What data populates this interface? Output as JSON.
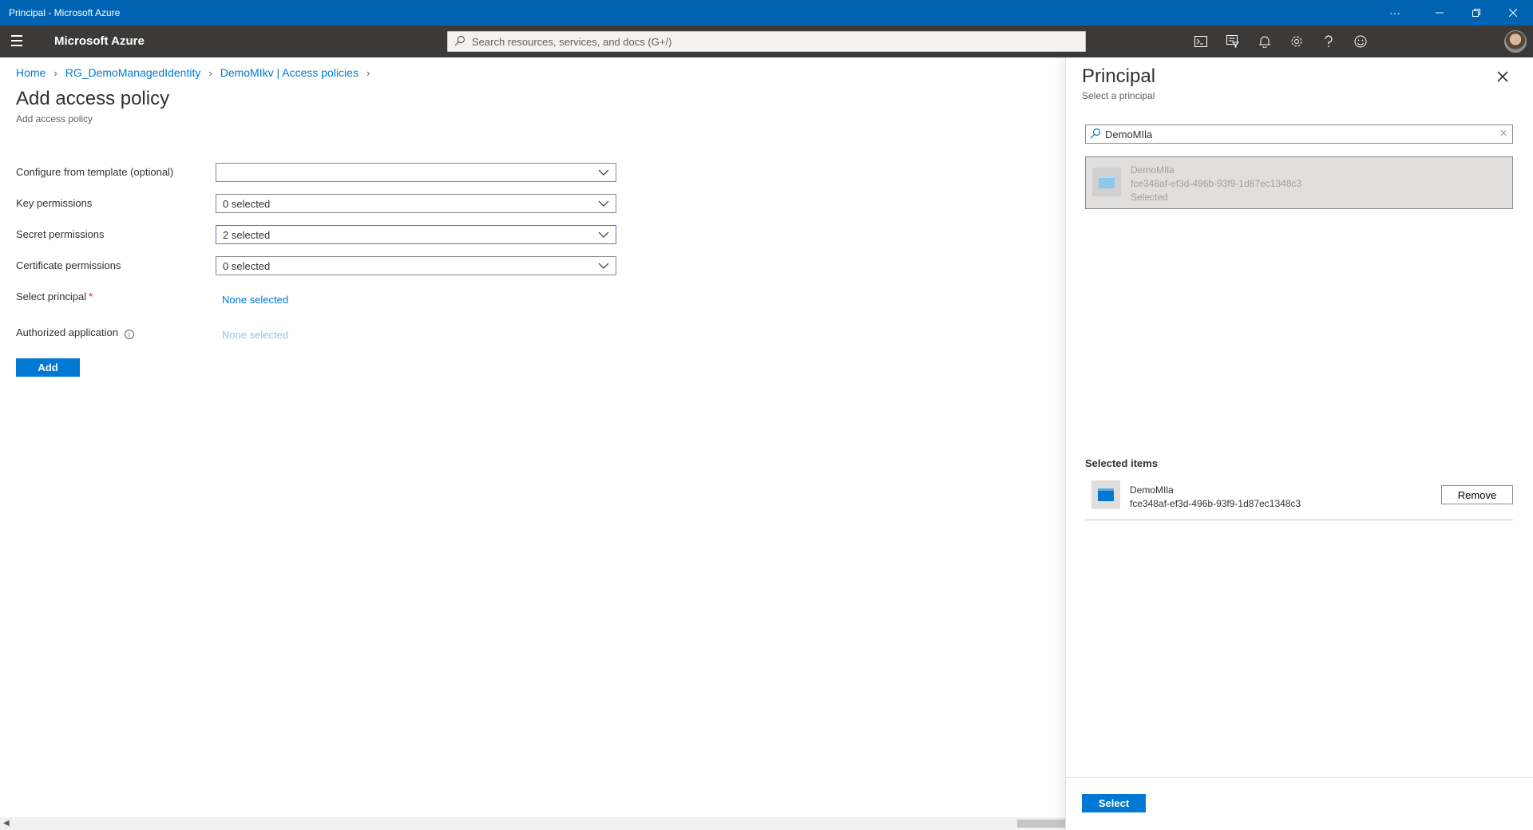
{
  "window": {
    "title": "Principal - Microsoft Azure",
    "more_label": "···"
  },
  "header": {
    "brand": "Microsoft Azure",
    "search_placeholder": "Search resources, services, and docs (G+/)"
  },
  "breadcrumb": [
    {
      "label": "Home"
    },
    {
      "label": "RG_DemoManagedIdentity"
    },
    {
      "label": "DemoMIkv | Access policies"
    }
  ],
  "page": {
    "title": "Add access policy",
    "subtitle": "Add access policy"
  },
  "form": {
    "template_label": "Configure from template (optional)",
    "template_value": "",
    "key_label": "Key permissions",
    "key_value": "0 selected",
    "secret_label": "Secret permissions",
    "secret_value": "2 selected",
    "cert_label": "Certificate permissions",
    "cert_value": "0 selected",
    "principal_label": "Select principal",
    "principal_required": "*",
    "principal_value": "None selected",
    "authapp_label": "Authorized application",
    "authapp_value": "None selected",
    "add_label": "Add"
  },
  "panel": {
    "title": "Principal",
    "subtitle": "Select a principal",
    "search_value": "DemoMIla",
    "result": {
      "name": "DemoMIla",
      "id": "fce348af-ef3d-496b-93f9-1d87ec1348c3",
      "status": "Selected"
    },
    "selected_heading": "Selected items",
    "selected_item": {
      "name": "DemoMIla",
      "id": "fce348af-ef3d-496b-93f9-1d87ec1348c3"
    },
    "remove_label": "Remove",
    "select_label": "Select"
  },
  "colors": {
    "accent": "#0078d4",
    "titlebar": "#0063b1",
    "header": "#3b3a39"
  }
}
